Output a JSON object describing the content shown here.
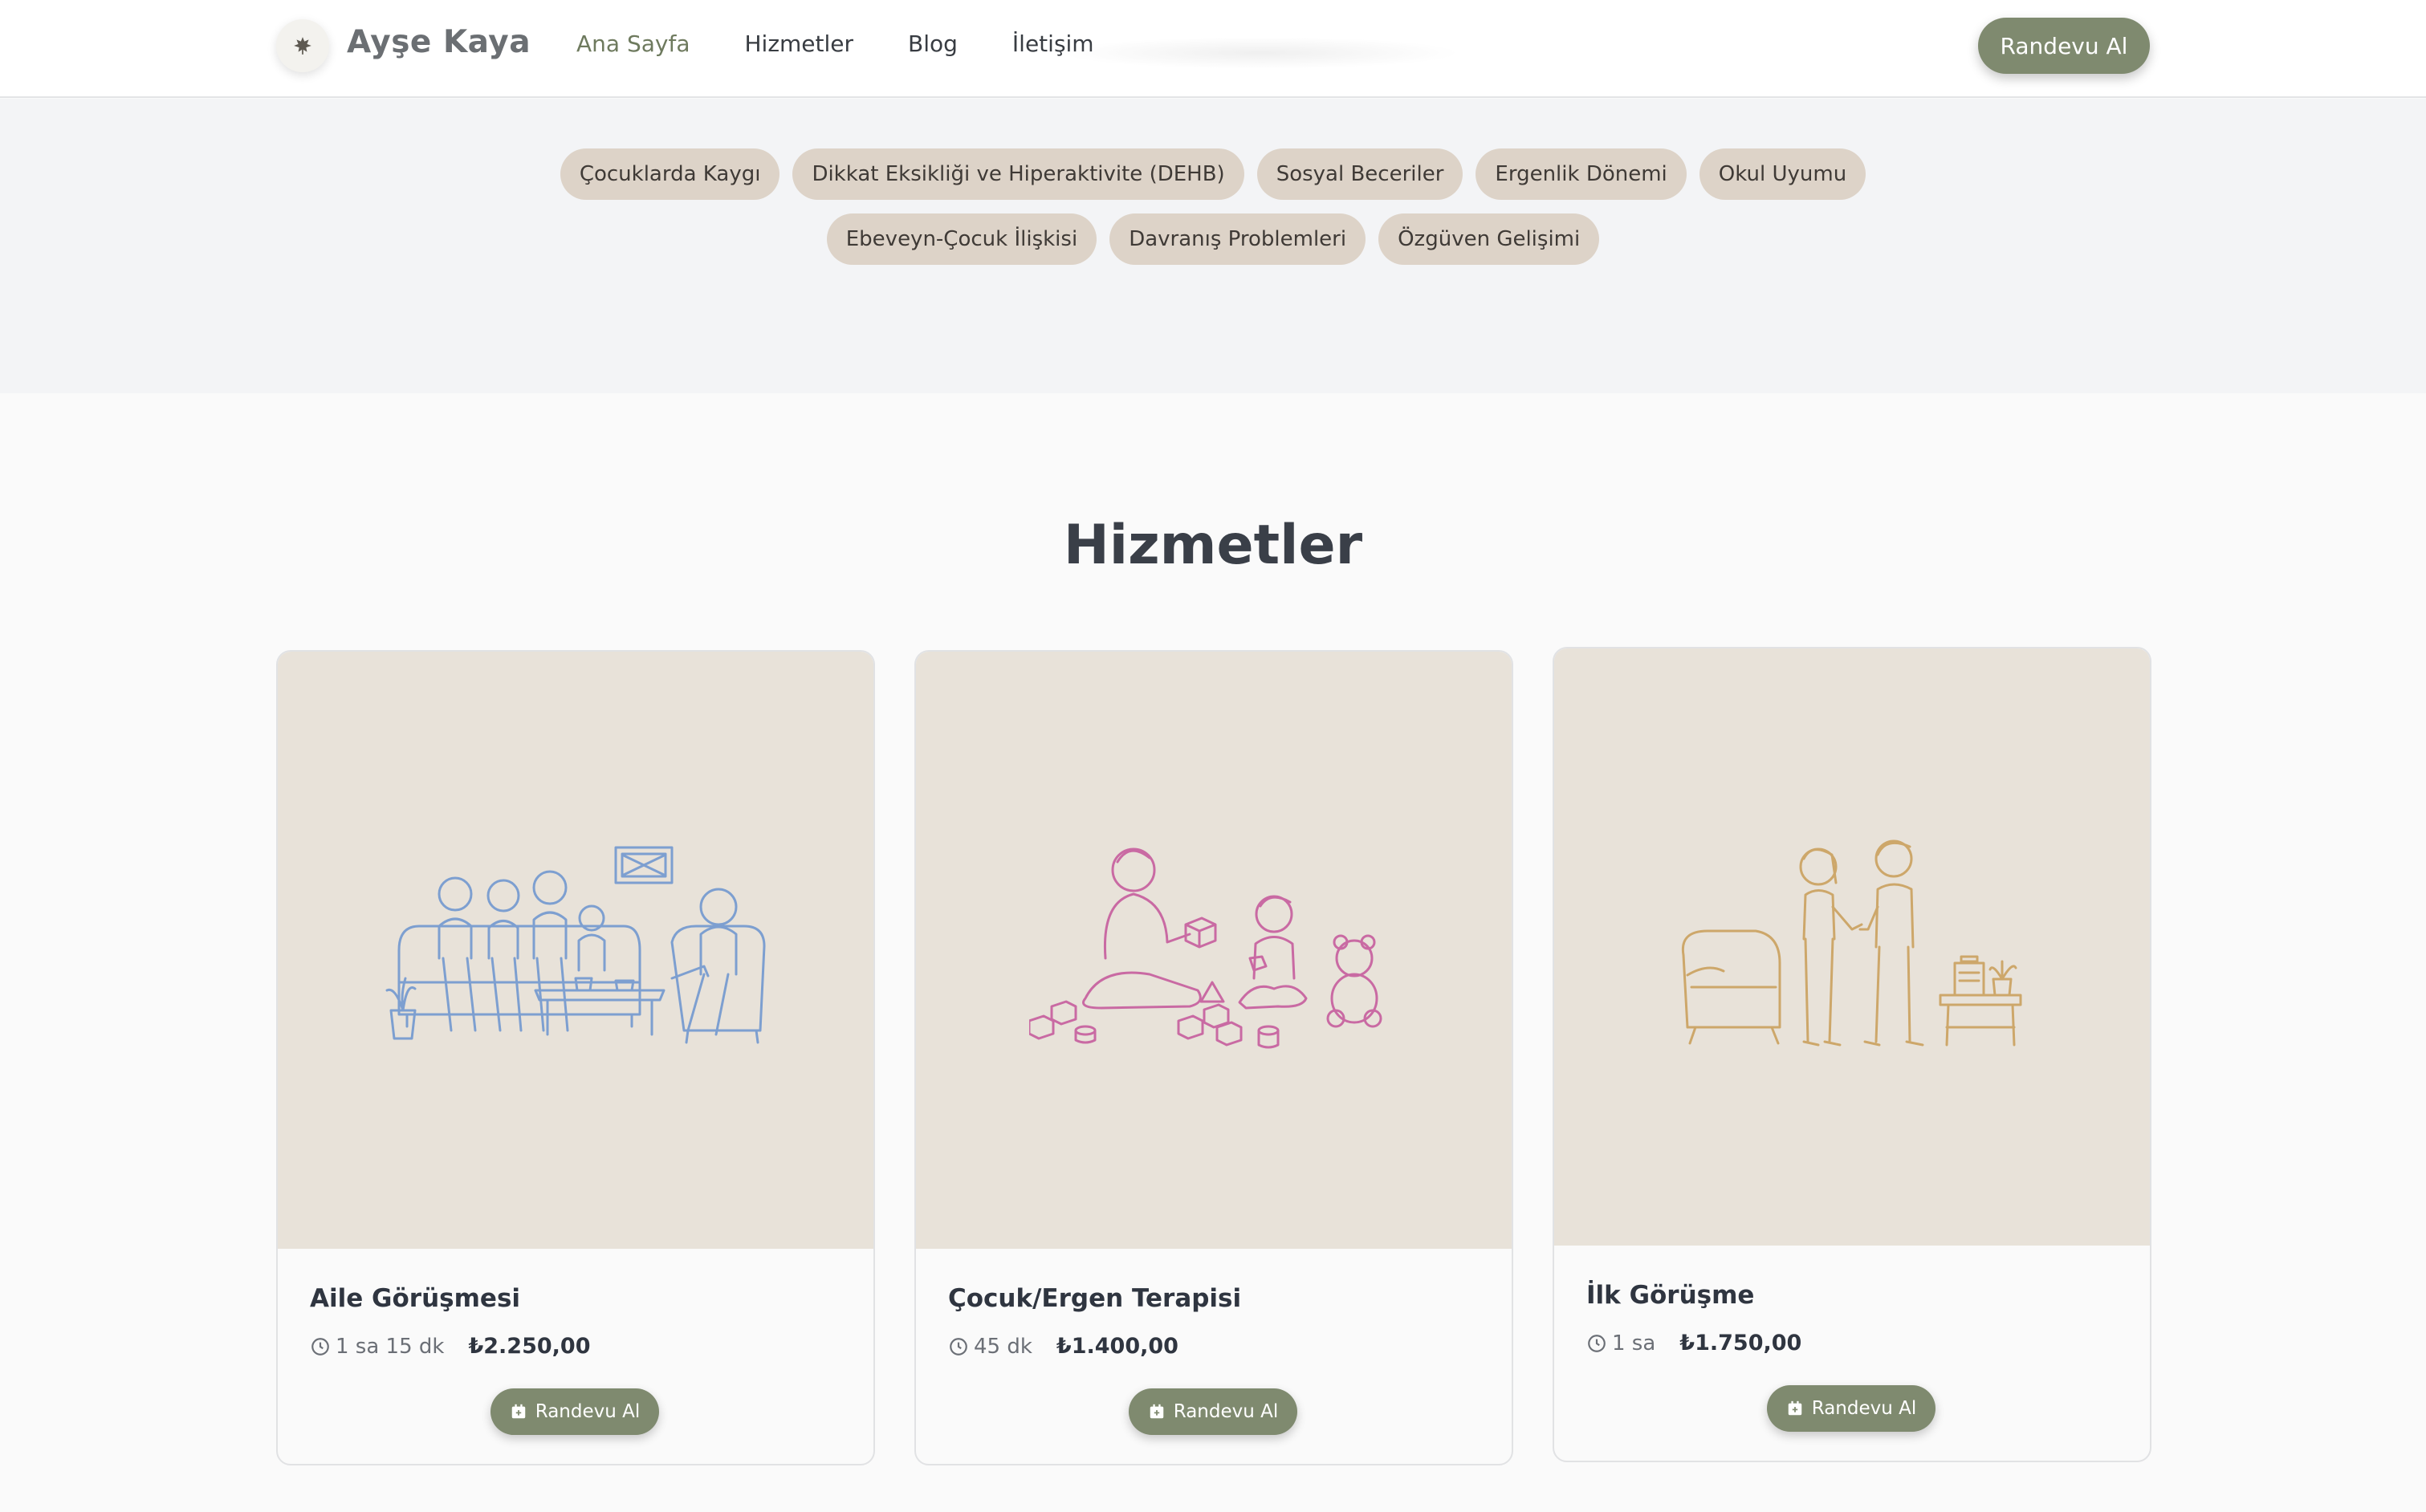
{
  "header": {
    "brand": "Ayşe Kaya",
    "logo_icon": "leaf-icon",
    "nav": [
      {
        "label": "Ana Sayfa",
        "active": true
      },
      {
        "label": "Hizmetler",
        "active": false
      },
      {
        "label": "Blog",
        "active": false
      },
      {
        "label": "İletişim",
        "active": false
      }
    ],
    "cta_label": "Randevu Al"
  },
  "tags": {
    "row1": [
      "Çocuklarda Kaygı",
      "Dikkat Eksikliği ve Hiperaktivite (DEHB)",
      "Sosyal Beceriler",
      "Ergenlik Dönemi",
      "Okul Uyumu"
    ],
    "row2": [
      "Ebeveyn-Çocuk İlişkisi",
      "Davranış Problemleri",
      "Özgüven Gelişimi"
    ]
  },
  "services": {
    "title": "Hizmetler",
    "items": [
      {
        "title": "Aile Görüşmesi",
        "duration": "1 sa 15 dk",
        "price": "₺2.250,00",
        "button": "Randevu Al",
        "illustration": "family-therapy-illustration",
        "color": "#7d9fd0"
      },
      {
        "title": "Çocuk/Ergen Terapisi",
        "duration": "45 dk",
        "price": "₺1.400,00",
        "button": "Randevu Al",
        "illustration": "child-play-therapy-illustration",
        "color": "#c96aa3"
      },
      {
        "title": "İlk Görüşme",
        "duration": "1 sa",
        "price": "₺1.750,00",
        "button": "Randevu Al",
        "illustration": "handshake-illustration",
        "color": "#cda76a"
      }
    ]
  },
  "colors": {
    "accent": "#7f8a6f",
    "tag_bg": "#ddd3c8",
    "card_media_bg": "#e8e2d9"
  }
}
